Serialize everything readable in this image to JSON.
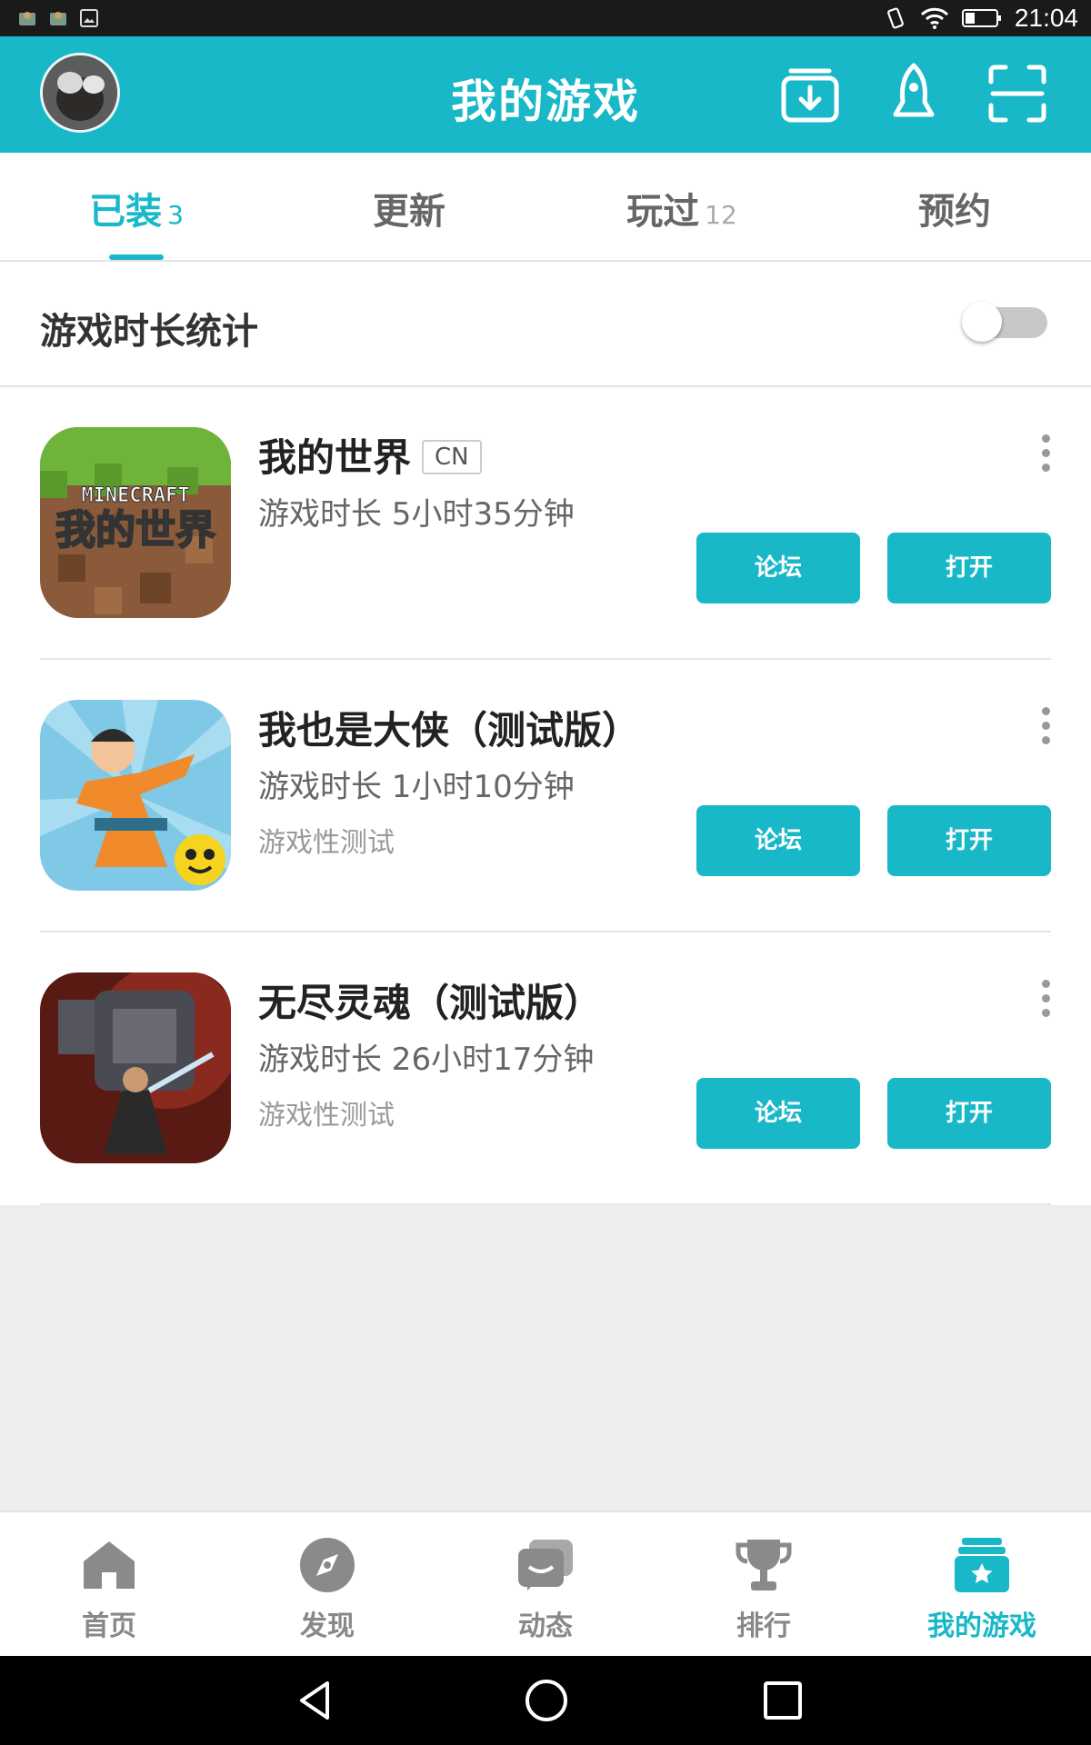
{
  "status_bar": {
    "time": "21:04"
  },
  "header": {
    "title": "我的游戏",
    "icons": [
      "download-icon",
      "rocket-icon",
      "scan-icon"
    ]
  },
  "tabs": [
    {
      "label": "已装",
      "count": "3",
      "active": true
    },
    {
      "label": "更新",
      "count": "",
      "active": false
    },
    {
      "label": "玩过",
      "count": "12",
      "active": false
    },
    {
      "label": "预约",
      "count": "",
      "active": false
    }
  ],
  "stats": {
    "label": "游戏时长统计",
    "toggle_on": false
  },
  "games": [
    {
      "name": "我的世界",
      "tag": "CN",
      "playtime": "游戏时长 5小时35分钟",
      "note": "",
      "forum_label": "论坛",
      "open_label": "打开",
      "icon_text_top": "MINECRAFT",
      "icon_text_bottom": "我的世界"
    },
    {
      "name": "我也是大侠（测试版）",
      "tag": "",
      "playtime": "游戏时长 1小时10分钟",
      "note": "游戏性测试",
      "forum_label": "论坛",
      "open_label": "打开"
    },
    {
      "name": "无尽灵魂（测试版）",
      "tag": "",
      "playtime": "游戏时长 26小时17分钟",
      "note": "游戏性测试",
      "forum_label": "论坛",
      "open_label": "打开"
    }
  ],
  "bottom_nav": [
    {
      "label": "首页",
      "icon": "home-icon",
      "active": false
    },
    {
      "label": "发现",
      "icon": "compass-icon",
      "active": false
    },
    {
      "label": "动态",
      "icon": "chat-icon",
      "active": false
    },
    {
      "label": "排行",
      "icon": "trophy-icon",
      "active": false
    },
    {
      "label": "我的游戏",
      "icon": "my-games-icon",
      "active": true
    }
  ],
  "colors": {
    "accent": "#19b8c8",
    "inactive": "#888888"
  }
}
